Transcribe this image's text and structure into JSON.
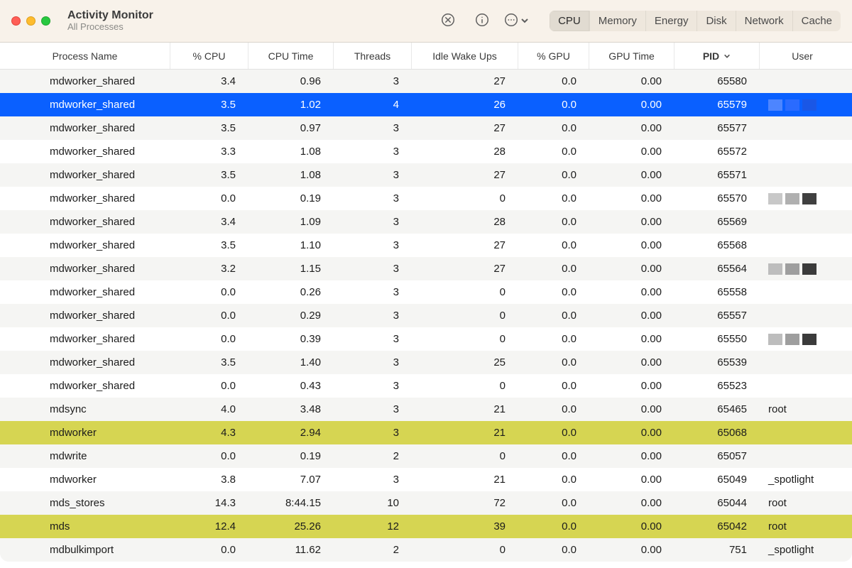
{
  "window": {
    "title": "Activity Monitor",
    "subtitle": "All Processes"
  },
  "tabs": {
    "items": [
      "CPU",
      "Memory",
      "Energy",
      "Disk",
      "Network",
      "Cache"
    ],
    "active_index": 0
  },
  "columns": [
    {
      "key": "name",
      "label": "Process Name"
    },
    {
      "key": "cpu",
      "label": "% CPU"
    },
    {
      "key": "cputime",
      "label": "CPU Time"
    },
    {
      "key": "threads",
      "label": "Threads"
    },
    {
      "key": "idle",
      "label": "Idle Wake Ups"
    },
    {
      "key": "gpu",
      "label": "% GPU"
    },
    {
      "key": "gputime",
      "label": "GPU Time"
    },
    {
      "key": "pid",
      "label": "PID",
      "sorted": "desc"
    },
    {
      "key": "user",
      "label": "User"
    }
  ],
  "rows": [
    {
      "name": "mdworker_shared",
      "cpu": "3.4",
      "cputime": "0.96",
      "threads": "3",
      "idle": "27",
      "gpu": "0.0",
      "gputime": "0.00",
      "pid": "65580",
      "user": "",
      "selected": false,
      "highlight": false
    },
    {
      "name": "mdworker_shared",
      "cpu": "3.5",
      "cputime": "1.02",
      "threads": "4",
      "idle": "26",
      "gpu": "0.0",
      "gputime": "0.00",
      "pid": "65579",
      "user": "",
      "selected": true,
      "highlight": false,
      "redact": [
        "#4d85ff",
        "#2a6bff",
        "#1a57e6"
      ]
    },
    {
      "name": "mdworker_shared",
      "cpu": "3.5",
      "cputime": "0.97",
      "threads": "3",
      "idle": "27",
      "gpu": "0.0",
      "gputime": "0.00",
      "pid": "65577",
      "user": "",
      "selected": false,
      "highlight": false
    },
    {
      "name": "mdworker_shared",
      "cpu": "3.3",
      "cputime": "1.08",
      "threads": "3",
      "idle": "28",
      "gpu": "0.0",
      "gputime": "0.00",
      "pid": "65572",
      "user": "",
      "selected": false,
      "highlight": false
    },
    {
      "name": "mdworker_shared",
      "cpu": "3.5",
      "cputime": "1.08",
      "threads": "3",
      "idle": "27",
      "gpu": "0.0",
      "gputime": "0.00",
      "pid": "65571",
      "user": "",
      "selected": false,
      "highlight": false
    },
    {
      "name": "mdworker_shared",
      "cpu": "0.0",
      "cputime": "0.19",
      "threads": "3",
      "idle": "0",
      "gpu": "0.0",
      "gputime": "0.00",
      "pid": "65570",
      "user": "",
      "selected": false,
      "highlight": false,
      "redact": [
        "#c8c8c8",
        "#b0b0b0",
        "#404040"
      ]
    },
    {
      "name": "mdworker_shared",
      "cpu": "3.4",
      "cputime": "1.09",
      "threads": "3",
      "idle": "28",
      "gpu": "0.0",
      "gputime": "0.00",
      "pid": "65569",
      "user": "",
      "selected": false,
      "highlight": false
    },
    {
      "name": "mdworker_shared",
      "cpu": "3.5",
      "cputime": "1.10",
      "threads": "3",
      "idle": "27",
      "gpu": "0.0",
      "gputime": "0.00",
      "pid": "65568",
      "user": "",
      "selected": false,
      "highlight": false
    },
    {
      "name": "mdworker_shared",
      "cpu": "3.2",
      "cputime": "1.15",
      "threads": "3",
      "idle": "27",
      "gpu": "0.0",
      "gputime": "0.00",
      "pid": "65564",
      "user": "",
      "selected": false,
      "highlight": false,
      "redact": [
        "#bdbdbd",
        "#9e9e9e",
        "#3b3b3b"
      ]
    },
    {
      "name": "mdworker_shared",
      "cpu": "0.0",
      "cputime": "0.26",
      "threads": "3",
      "idle": "0",
      "gpu": "0.0",
      "gputime": "0.00",
      "pid": "65558",
      "user": "",
      "selected": false,
      "highlight": false
    },
    {
      "name": "mdworker_shared",
      "cpu": "0.0",
      "cputime": "0.29",
      "threads": "3",
      "idle": "0",
      "gpu": "0.0",
      "gputime": "0.00",
      "pid": "65557",
      "user": "",
      "selected": false,
      "highlight": false
    },
    {
      "name": "mdworker_shared",
      "cpu": "0.0",
      "cputime": "0.39",
      "threads": "3",
      "idle": "0",
      "gpu": "0.0",
      "gputime": "0.00",
      "pid": "65550",
      "user": "",
      "selected": false,
      "highlight": false,
      "redact": [
        "#bdbdbd",
        "#9e9e9e",
        "#3b3b3b"
      ]
    },
    {
      "name": "mdworker_shared",
      "cpu": "3.5",
      "cputime": "1.40",
      "threads": "3",
      "idle": "25",
      "gpu": "0.0",
      "gputime": "0.00",
      "pid": "65539",
      "user": "",
      "selected": false,
      "highlight": false
    },
    {
      "name": "mdworker_shared",
      "cpu": "0.0",
      "cputime": "0.43",
      "threads": "3",
      "idle": "0",
      "gpu": "0.0",
      "gputime": "0.00",
      "pid": "65523",
      "user": "",
      "selected": false,
      "highlight": false
    },
    {
      "name": "mdsync",
      "cpu": "4.0",
      "cputime": "3.48",
      "threads": "3",
      "idle": "21",
      "gpu": "0.0",
      "gputime": "0.00",
      "pid": "65465",
      "user": "root",
      "selected": false,
      "highlight": false
    },
    {
      "name": "mdworker",
      "cpu": "4.3",
      "cputime": "2.94",
      "threads": "3",
      "idle": "21",
      "gpu": "0.0",
      "gputime": "0.00",
      "pid": "65068",
      "user": "",
      "selected": false,
      "highlight": true
    },
    {
      "name": "mdwrite",
      "cpu": "0.0",
      "cputime": "0.19",
      "threads": "2",
      "idle": "0",
      "gpu": "0.0",
      "gputime": "0.00",
      "pid": "65057",
      "user": "",
      "selected": false,
      "highlight": false
    },
    {
      "name": "mdworker",
      "cpu": "3.8",
      "cputime": "7.07",
      "threads": "3",
      "idle": "21",
      "gpu": "0.0",
      "gputime": "0.00",
      "pid": "65049",
      "user": "_spotlight",
      "selected": false,
      "highlight": false
    },
    {
      "name": "mds_stores",
      "cpu": "14.3",
      "cputime": "8:44.15",
      "threads": "10",
      "idle": "72",
      "gpu": "0.0",
      "gputime": "0.00",
      "pid": "65044",
      "user": "root",
      "selected": false,
      "highlight": false
    },
    {
      "name": "mds",
      "cpu": "12.4",
      "cputime": "25.26",
      "threads": "12",
      "idle": "39",
      "gpu": "0.0",
      "gputime": "0.00",
      "pid": "65042",
      "user": "root",
      "selected": false,
      "highlight": true
    },
    {
      "name": "mdbulkimport",
      "cpu": "0.0",
      "cputime": "11.62",
      "threads": "2",
      "idle": "0",
      "gpu": "0.0",
      "gputime": "0.00",
      "pid": "751",
      "user": "_spotlight",
      "selected": false,
      "highlight": false
    }
  ]
}
